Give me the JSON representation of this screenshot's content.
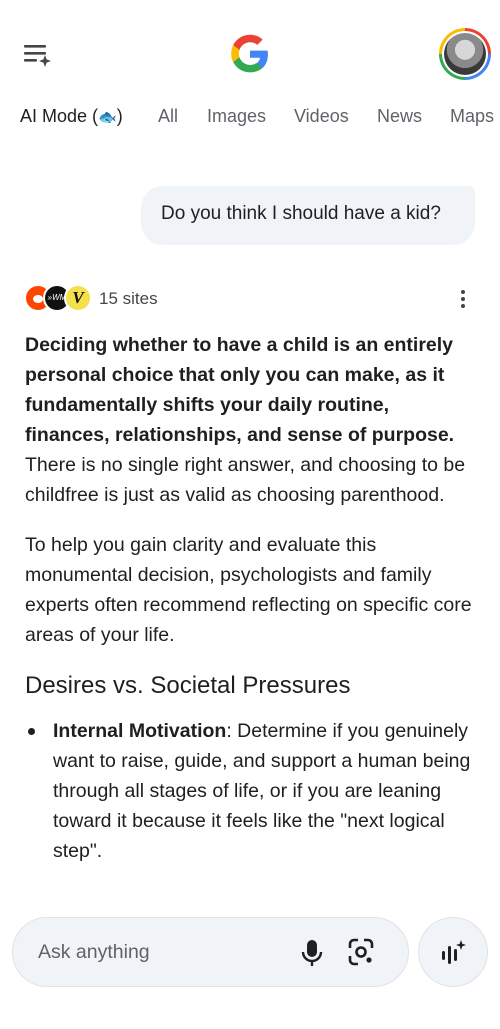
{
  "header": {
    "menu_icon": "menu-sparkle-icon",
    "logo_icon": "google-g-logo",
    "avatar_icon": "account-avatar"
  },
  "tabs": [
    {
      "label": "AI Mode (",
      "suffix": ")",
      "active": true
    },
    {
      "label": "All"
    },
    {
      "label": "Images"
    },
    {
      "label": "Videos"
    },
    {
      "label": "News"
    },
    {
      "label": "Maps"
    }
  ],
  "user_query": "Do you think I should have a kid?",
  "sources": {
    "count_label": "15 sites",
    "icons": [
      "reddit-icon",
      "site-icon",
      "v-site-icon"
    ],
    "v_letter": "V",
    "black_text": "»WM"
  },
  "answer": {
    "p1_bold": "Deciding whether to have a child is an entirely personal choice that only you can make, as it fundamentally shifts your daily routine, finances, relationships, and sense of purpose.",
    "p1_rest": " There is no single right answer, and choosing to be childfree is just as valid as choosing parenthood.",
    "p2": "To help you gain clarity and evaluate this monumental decision, psychologists and family experts often recommend reflecting on specific core areas of your life.",
    "heading": "Desires vs. Societal Pressures",
    "bullet1_bold": "Internal Motivation",
    "bullet1_rest": ": Determine if you genuinely want to raise, guide, and support a human being through all stages of life, or if you are leaning toward it because it feels like the \"next logical step\"."
  },
  "input": {
    "placeholder": "Ask anything",
    "mic_icon": "mic-icon",
    "lens_icon": "lens-icon",
    "live_icon": "live-voice-icon"
  },
  "colors": {
    "google_blue": "#4285f4",
    "google_red": "#ea4335",
    "google_yellow": "#fbbc05",
    "google_green": "#34a853",
    "bubble_bg": "#f0f4f9"
  }
}
